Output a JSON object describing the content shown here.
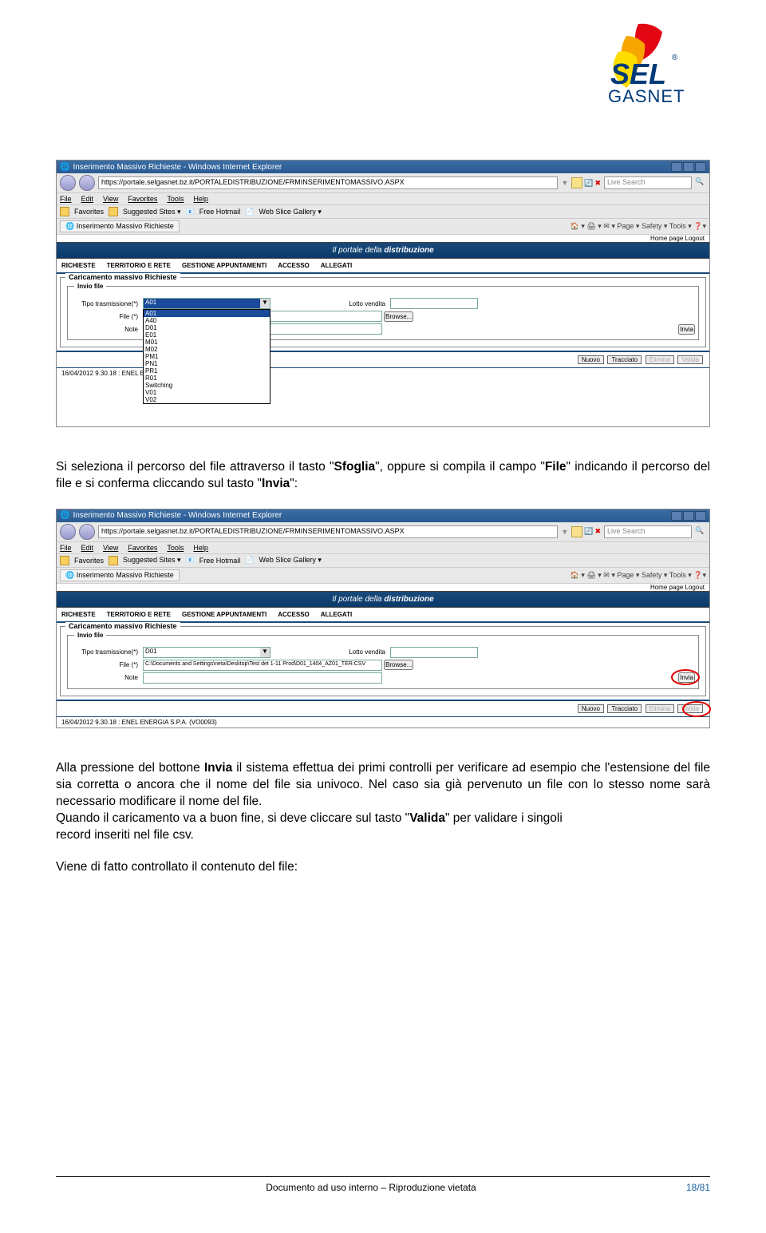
{
  "logo": {
    "brand_top": "SEL",
    "brand_bottom": "GASNET",
    "reg": "®"
  },
  "screenshot1": {
    "window_title": "Inserimento Massivo Richieste - Windows Internet Explorer",
    "url": "https://portale.selgasnet.bz.it/PORTALEDISTRIBUZIONE/FRMINSERIMENTOMASSIVO.ASPX",
    "live_search": "Live Search",
    "menubar": [
      "File",
      "Edit",
      "View",
      "Favorites",
      "Tools",
      "Help"
    ],
    "favbar_label": "Favorites",
    "favbar_items": [
      "Suggested Sites ▾",
      "Free Hotmail",
      "Web Slice Gallery ▾"
    ],
    "tab_title": "Inserimento Massivo Richieste",
    "tools": "🏠 ▾   🖨 ▾   ✉ ▾   Page ▾   Safety ▾   Tools ▾   ❓▾",
    "header_links": "Home page   Logout",
    "banner_pre": "Il portale della ",
    "banner_emph": "distribuzione",
    "nav": [
      "RICHIESTE",
      "TERRITORIO E RETE",
      "GESTIONE APPUNTAMENTI",
      "ACCESSO",
      "ALLEGATI"
    ],
    "fieldset_legend": "Caricamento massivo Richieste",
    "inner_legend": "Invio file",
    "lbl_tipo": "Tipo trasmissione(*)",
    "lbl_file": "File (*)",
    "lbl_note": "Note",
    "lbl_lotto": "Lotto vendita",
    "browse": "Browse...",
    "invia": "Invia",
    "select_value": "A01",
    "select_options": [
      "A01",
      "A40",
      "D01",
      "E01",
      "M01",
      "M02",
      "PM1",
      "PN1",
      "PR1",
      "R01",
      "Switching",
      "V01",
      "V02"
    ],
    "btns": {
      "nuovo": "Nuovo",
      "tracciato": "Tracciato",
      "elimina": "Elimina",
      "valida": "Valida"
    },
    "status": "16/04/2012 9.30.18  :  ENEL E"
  },
  "para1": {
    "pre": "Si seleziona il percorso del file attraverso il tasto \"",
    "b1": "Sfoglia",
    "mid1": "\", oppure si compila il campo \"",
    "b2": "File",
    "mid2": "\" indicando il percorso del file e si conferma cliccando sul tasto \"",
    "b3": "Invia",
    "post": "\":"
  },
  "screenshot2": {
    "window_title": "Inserimento Massivo Richieste - Windows Internet Explorer",
    "url": "https://portale.selgasnet.bz.it/PORTALEDISTRIBUZIONE/FRMINSERIMENTOMASSIVO.ASPX",
    "live_search": "Live Search",
    "menubar": [
      "File",
      "Edit",
      "View",
      "Favorites",
      "Tools",
      "Help"
    ],
    "favbar_label": "Favorites",
    "favbar_items": [
      "Suggested Sites ▾",
      "Free Hotmail",
      "Web Slice Gallery ▾"
    ],
    "tab_title": "Inserimento Massivo Richieste",
    "tools": "🏠 ▾   🖨 ▾   ✉ ▾   Page ▾   Safety ▾   Tools ▾   ❓▾",
    "header_links": "Home page   Logout",
    "banner_pre": "Il portale della ",
    "banner_emph": "distribuzione",
    "nav": [
      "RICHIESTE",
      "TERRITORIO E RETE",
      "GESTIONE APPUNTAMENTI",
      "ACCESSO",
      "ALLEGATI"
    ],
    "fieldset_legend": "Caricamento massivo Richieste",
    "inner_legend": "Invio file",
    "lbl_tipo": "Tipo trasmissione(*)",
    "lbl_file": "File (*)",
    "lbl_note": "Note",
    "lbl_lotto": "Lotto vendita",
    "browse": "Browse...",
    "invia": "Invia",
    "select_value": "D01",
    "file_value": "C:\\Documents and Settings\\neta\\Desktop\\Test det 1-11 Prod\\D01_1404_AZ01_TER.CSV",
    "btns": {
      "nuovo": "Nuovo",
      "tracciato": "Tracciato",
      "elimina": "Elimina",
      "valida": "Valida"
    },
    "status": "16/04/2012 9.30.18  :  ENEL ENERGIA S.P.A.   (VO0093)"
  },
  "para2": {
    "pre": "Alla pressione del bottone ",
    "b1": "Invia",
    "mid1": " il sistema effettua dei primi controlli per verificare ad esempio che l'estensione del file sia corretta o ancora che il nome del file sia univoco. Nel caso sia già pervenuto un file con lo stesso nome sarà necessario modificare il nome del file.",
    "line2_pre": "Quando il caricamento va a buon fine, si deve cliccare sul tasto \"",
    "b2": "Valida",
    "line2_post": "\" per validare i singoli",
    "line3": "record inseriti nel file csv.",
    "line4": "Viene di fatto controllato il contenuto del file:"
  },
  "footer": {
    "center": "Documento ad uso interno – Riproduzione vietata",
    "page": "18/81"
  }
}
